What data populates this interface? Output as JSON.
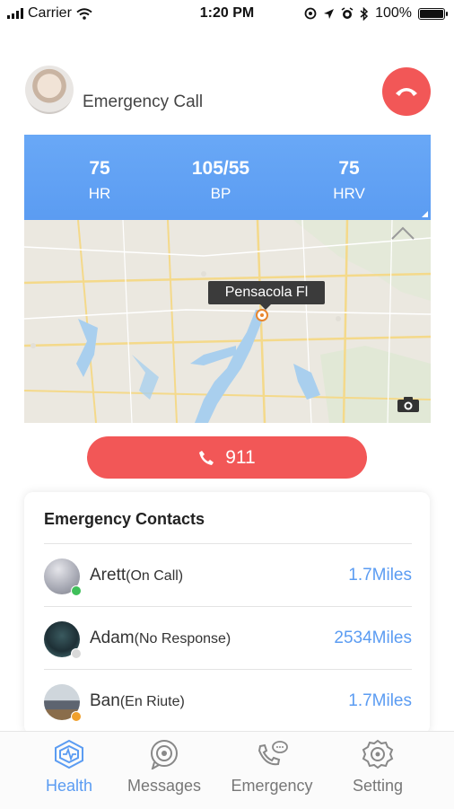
{
  "status_bar": {
    "carrier": "Carrier",
    "time": "1:20 PM",
    "battery": "100%"
  },
  "header": {
    "title": "Emergency Call"
  },
  "vitals": [
    {
      "value": "75",
      "label": "HR"
    },
    {
      "value": "105/55",
      "label": "BP"
    },
    {
      "value": "75",
      "label": "HRV"
    }
  ],
  "map": {
    "location_label": "Pensacola Fl"
  },
  "emergency_button": {
    "label": "911"
  },
  "contacts": {
    "title": "Emergency Contacts",
    "items": [
      {
        "name": "Arett",
        "status": "(On Call)",
        "distance": "1.7Miles",
        "status_color": "#3fbf5a"
      },
      {
        "name": "Adam",
        "status": "(No Response)",
        "distance": "2534Miles",
        "status_color": "#d9d9d9"
      },
      {
        "name": "Ban",
        "status": "(En Riute)",
        "distance": "1.7Miles",
        "status_color": "#f0a02c"
      }
    ]
  },
  "tabs": [
    {
      "label": "Health",
      "icon": "health-icon",
      "active": true
    },
    {
      "label": "Messages",
      "icon": "messages-icon",
      "active": false
    },
    {
      "label": "Emergency",
      "icon": "emergency-icon",
      "active": false
    },
    {
      "label": "Setting",
      "icon": "gear-icon",
      "active": false
    }
  ],
  "colors": {
    "accent_blue": "#5b9cf2",
    "alert_red": "#f25757"
  }
}
